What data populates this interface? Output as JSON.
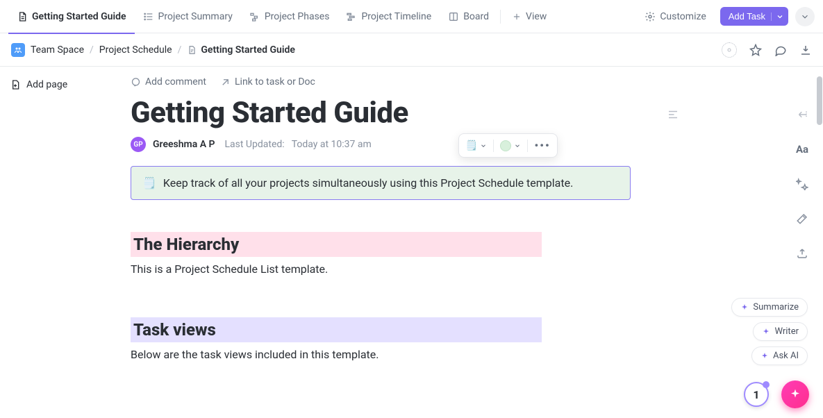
{
  "tabs": [
    {
      "label": "Getting Started Guide",
      "active": true,
      "icon": "doc"
    },
    {
      "label": "Project Summary",
      "active": false,
      "icon": "list"
    },
    {
      "label": "Project Phases",
      "active": false,
      "icon": "phases"
    },
    {
      "label": "Project Timeline",
      "active": false,
      "icon": "timeline"
    },
    {
      "label": "Board",
      "active": false,
      "icon": "board"
    }
  ],
  "view_button": "View",
  "customize_label": "Customize",
  "add_task_label": "Add Task",
  "breadcrumb": {
    "space": "Team Space",
    "list": "Project Schedule",
    "doc": "Getting Started Guide"
  },
  "sidebar": {
    "add_page": "Add page"
  },
  "doc_actions": {
    "add_comment": "Add comment",
    "link_task": "Link to task or Doc"
  },
  "page_title": "Getting Started Guide",
  "author": {
    "initials": "GP",
    "name": "Greeshma A P"
  },
  "updated": {
    "label": "Last Updated:",
    "value": "Today at 10:37 am"
  },
  "callout": {
    "emoji": "🗒️",
    "text": "Keep track of all your projects simultaneously using this Project Schedule template."
  },
  "popover": {
    "emoji": "🗒️"
  },
  "sections": {
    "hierarchy": {
      "title": "The Hierarchy",
      "body": "This is a Project Schedule List template."
    },
    "task_views": {
      "title": "Task views",
      "body": "Below are the task views included in this template."
    }
  },
  "right_rail": {
    "aa": "Aa"
  },
  "ai": {
    "summarize": "Summarize",
    "writer": "Writer",
    "ask": "Ask AI"
  },
  "notif_count": "1"
}
